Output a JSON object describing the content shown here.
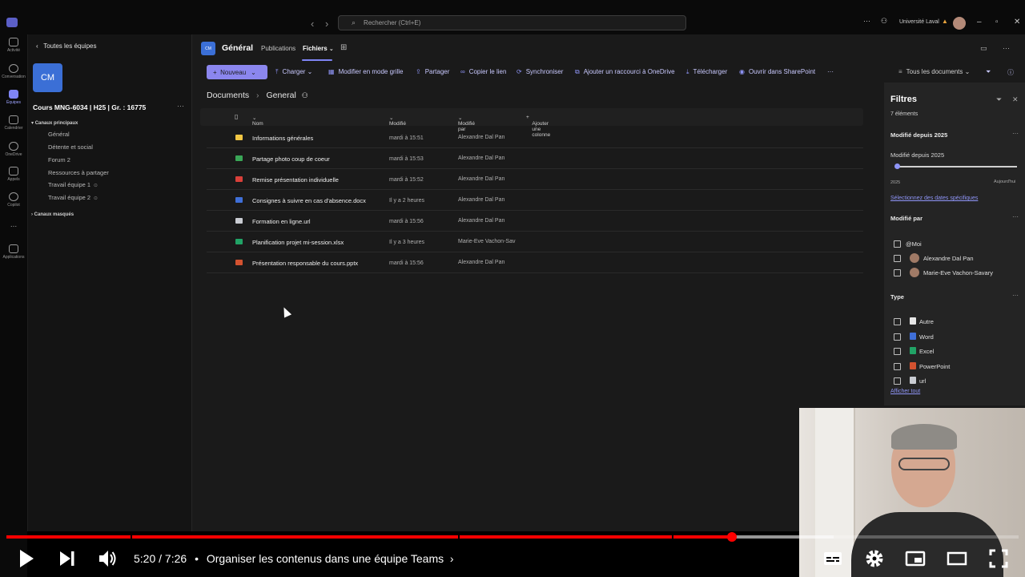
{
  "titlebar": {
    "search_placeholder": "Rechercher (Ctrl+E)",
    "org_name": "Université Laval"
  },
  "rail": [
    {
      "label": "Activité",
      "icon": "bell-icon"
    },
    {
      "label": "Conversation",
      "icon": "chat-icon"
    },
    {
      "label": "Équipes",
      "icon": "teams-icon",
      "active": true
    },
    {
      "label": "Calendrier",
      "icon": "calendar-icon"
    },
    {
      "label": "OneDrive",
      "icon": "cloud-icon"
    },
    {
      "label": "Appels",
      "icon": "phone-icon"
    },
    {
      "label": "Copilot",
      "icon": "copilot-icon"
    },
    {
      "label": "...",
      "icon": "more-icon"
    },
    {
      "label": "Applications",
      "icon": "apps-icon"
    }
  ],
  "sidebar": {
    "back_label": "Toutes les équipes",
    "team_initials": "CM",
    "team_name": "Cours MNG-6034 | H25 | Gr. : 16775",
    "section_main": "Canaux principaux",
    "channels": [
      "Général",
      "Détente et social",
      "Forum 2",
      "Ressources à partager",
      "Travail équipe 1",
      "Travail équipe 2"
    ],
    "section_hidden": "Canaux masqués"
  },
  "channel_header": {
    "badge": "CM",
    "title": "Général",
    "tabs": [
      "Publications",
      "Fichiers"
    ],
    "active_tab": "Fichiers"
  },
  "toolbar": {
    "new_label": "Nouveau",
    "items": [
      "Charger",
      "Modifier en mode grille",
      "Partager",
      "Copier le lien",
      "Synchroniser",
      "Ajouter un raccourci à OneDrive",
      "Télécharger",
      "Ouvrir dans SharePoint"
    ],
    "view_label": "Tous les documents"
  },
  "breadcrumb": {
    "root": "Documents",
    "current": "General"
  },
  "table": {
    "headers": {
      "name": "Nom",
      "modified": "Modifié",
      "modified_by": "Modifié par",
      "add_column": "Ajouter une colonne"
    },
    "rows": [
      {
        "name": "Informations générales",
        "modified": "mardi à 15:51",
        "by": "Alexandre Dal Pan",
        "color": "#f2c744"
      },
      {
        "name": "Partage photo coup de coeur",
        "modified": "mardi à 15:53",
        "by": "Alexandre Dal Pan",
        "color": "#3aa657"
      },
      {
        "name": "Remise présentation individuelle",
        "modified": "mardi à 15:52",
        "by": "Alexandre Dal Pan",
        "color": "#d9403a"
      },
      {
        "name": "Consignes à suivre en cas d'absence.docx",
        "modified": "Il y a 2 heures",
        "by": "Alexandre Dal Pan",
        "color": "#3f6fd8"
      },
      {
        "name": "Formation en ligne.url",
        "modified": "mardi à 15:56",
        "by": "Alexandre Dal Pan",
        "color": "#c9ccd2"
      },
      {
        "name": "Planification projet mi-session.xlsx",
        "modified": "Il y a 3 heures",
        "by": "Marie-Eve Vachon-Sav",
        "color": "#21a366"
      },
      {
        "name": "Présentation responsable du cours.pptx",
        "modified": "mardi à 15:56",
        "by": "Alexandre Dal Pan",
        "color": "#d35230"
      }
    ]
  },
  "filters": {
    "title": "Filtres",
    "count": "7 éléments",
    "modified_section": "Modifié depuis 2025",
    "modified_label": "Modifié depuis 2025",
    "slider_start": "2025",
    "slider_end": "Aujourd'hui",
    "specific_dates_link": "Sélectionnez des dates spécifiques",
    "by_section": "Modifié par",
    "people": [
      "@Moi",
      "Alexandre Dal Pan",
      "Marie-Eve Vachon-Savary"
    ],
    "type_section": "Type",
    "types": [
      {
        "label": "Autre",
        "color": "#e6e6e6"
      },
      {
        "label": "Word",
        "color": "#3f6fd8"
      },
      {
        "label": "Excel",
        "color": "#21a366"
      },
      {
        "label": "PowerPoint",
        "color": "#d35230"
      },
      {
        "label": "url",
        "color": "#c9ccd2"
      }
    ],
    "show_all": "Afficher tout"
  },
  "player": {
    "current_time": "5:20",
    "duration": "7:26",
    "separator": "/",
    "chapter_title": "Organiser les contenus dans une équipe Teams",
    "progress_fraction": 0.717,
    "accent": "#ff0000"
  }
}
